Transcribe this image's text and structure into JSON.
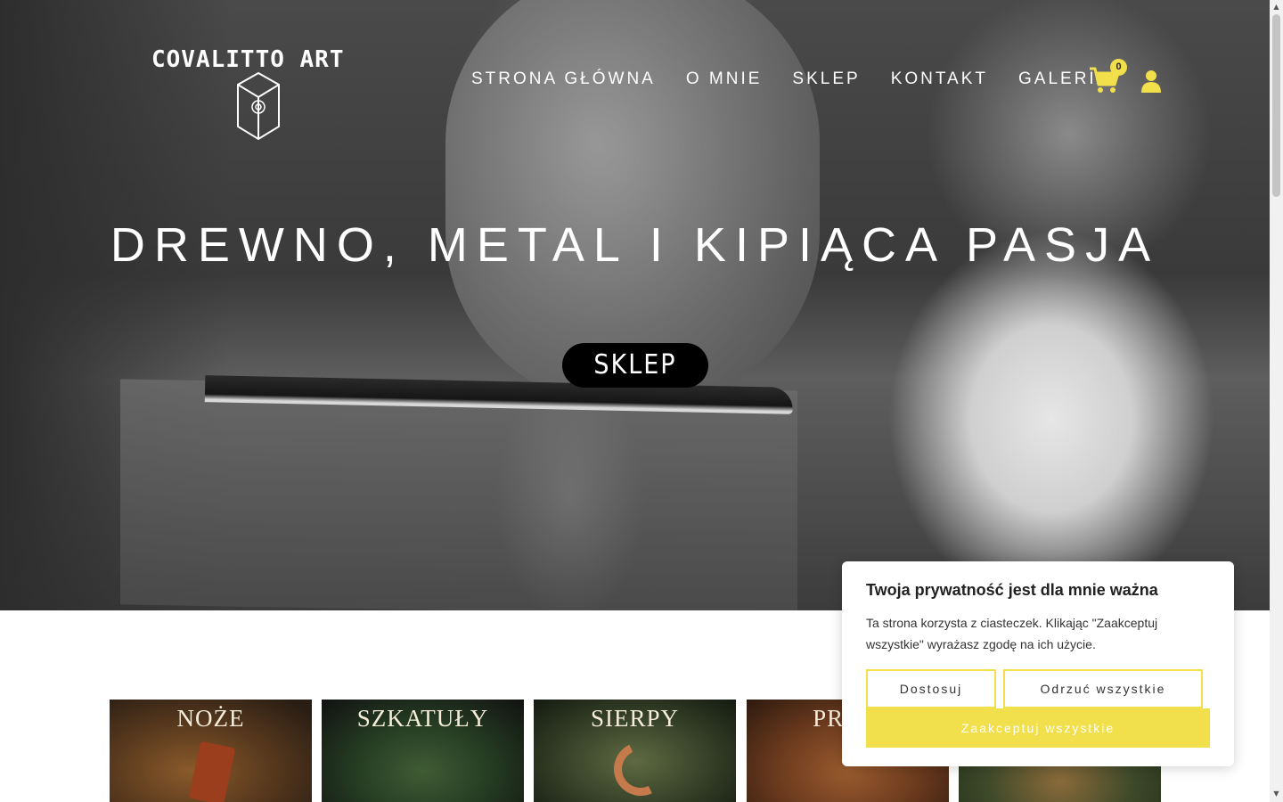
{
  "brand": {
    "logo_text": "COVALITTO ART",
    "accent_color": "#f1df4b"
  },
  "nav": {
    "items": [
      {
        "label": "STRONA GŁÓWNA"
      },
      {
        "label": "O MNIE"
      },
      {
        "label": "SKLEP"
      },
      {
        "label": "KONTAKT"
      },
      {
        "label": "GALERIA"
      }
    ],
    "cart_icon": "cart-icon",
    "cart_count": "0",
    "user_icon": "user-icon"
  },
  "hero": {
    "title": "DREWNO, METAL I KIPIĄCA PASJA",
    "button_label": "SKLEP"
  },
  "categories": [
    {
      "label": "NOŻE"
    },
    {
      "label": "SZKATUŁY"
    },
    {
      "label": "SIERPY"
    },
    {
      "label": "PRO..."
    },
    {
      "label": ""
    }
  ],
  "cookie": {
    "title": "Twoja prywatność jest dla mnie ważna",
    "text": "Ta strona korzysta z ciasteczek. Klikając \"Zaakceptuj wszystkie\" wyrażasz zgodę na ich użycie.",
    "customize_label": "Dostosuj",
    "reject_label": "Odrzuć wszystkie",
    "accept_label": "Zaakceptuj wszystkie"
  }
}
